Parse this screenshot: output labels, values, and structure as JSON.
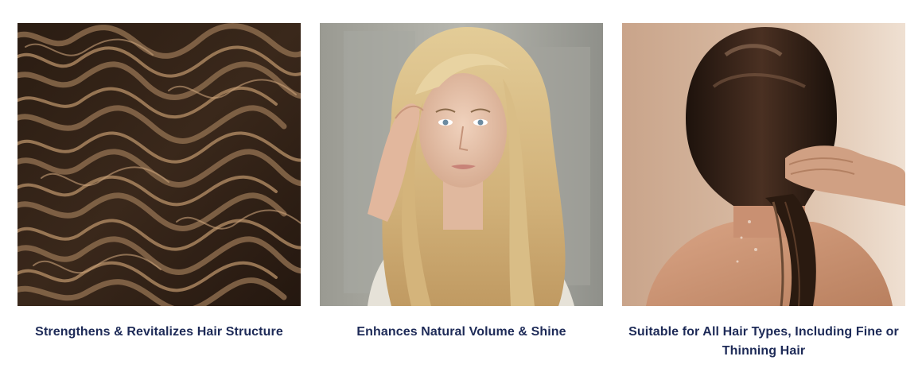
{
  "features": [
    {
      "image": "curly-hair-texture-photo",
      "caption": "Strengthens & Revitalizes Hair Structure"
    },
    {
      "image": "blonde-woman-portrait-photo",
      "caption": "Enhances Natural Volume & Shine"
    },
    {
      "image": "wet-hair-back-view-photo",
      "caption": "Suitable for All Hair Types, Including Fine or Thinning Hair"
    }
  ],
  "colors": {
    "caption_text": "#1d2a57",
    "background": "#ffffff"
  }
}
